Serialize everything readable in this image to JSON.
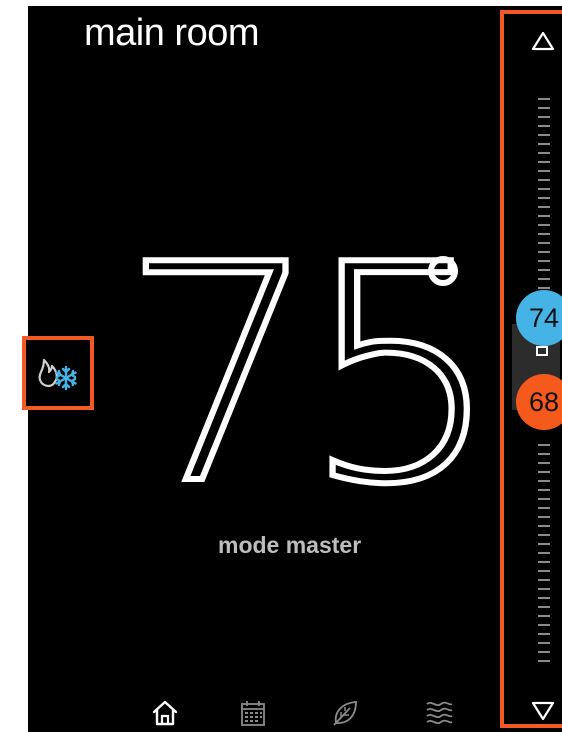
{
  "room": {
    "title": "main room"
  },
  "thermostat": {
    "current_temperature": "75",
    "degree_symbol": "°",
    "mode_name": "mode master"
  },
  "mode_button": {
    "icon": "heat-cool-icon",
    "heat_color": "#ffffff",
    "cool_color": "#46b3e6"
  },
  "setpoints": {
    "cool": {
      "value": "74",
      "color": "#46b3e6"
    },
    "heat": {
      "value": "68",
      "color": "#f55a1c"
    }
  },
  "scale": {
    "up_icon": "triangle-up-icon",
    "down_icon": "triangle-down-icon"
  },
  "nav": {
    "items": [
      {
        "icon": "home-icon"
      },
      {
        "icon": "calendar-icon"
      },
      {
        "icon": "leaf-icon"
      },
      {
        "icon": "waves-icon"
      }
    ]
  },
  "highlight_color": "#f15a24"
}
